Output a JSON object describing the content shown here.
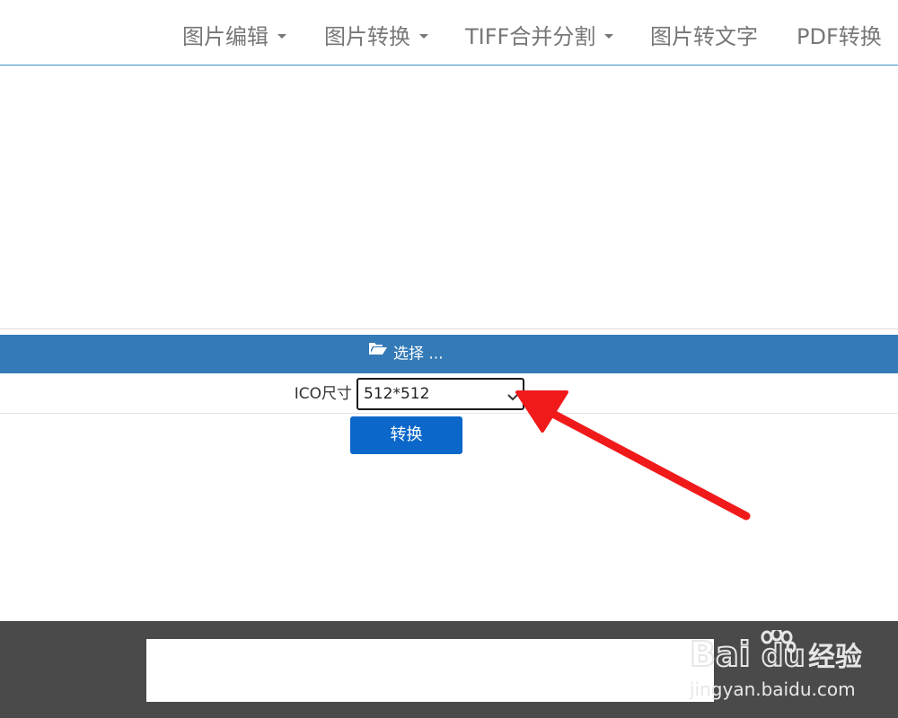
{
  "nav": {
    "items": [
      {
        "label": "图片编辑",
        "dropdown": true
      },
      {
        "label": "图片转换",
        "dropdown": true
      },
      {
        "label": "TIFF合并分割",
        "dropdown": true
      },
      {
        "label": "图片转文字",
        "dropdown": false
      },
      {
        "label": "PDF转换",
        "dropdown": false
      }
    ]
  },
  "upload": {
    "choose_label": "选择 ...",
    "icon": "folder-open-icon"
  },
  "form": {
    "size_label": "ICO尺寸",
    "size_value": "512*512",
    "convert_label": "转换"
  },
  "watermark": {
    "brand": "Bai",
    "brand_du": "du",
    "product": "经验",
    "url": "jingyan.baidu.com"
  },
  "colors": {
    "primary_bar": "#337ab7",
    "convert_button": "#0b67c9",
    "annotation_arrow": "#f01a1a",
    "footer": "#4a4a4a"
  }
}
